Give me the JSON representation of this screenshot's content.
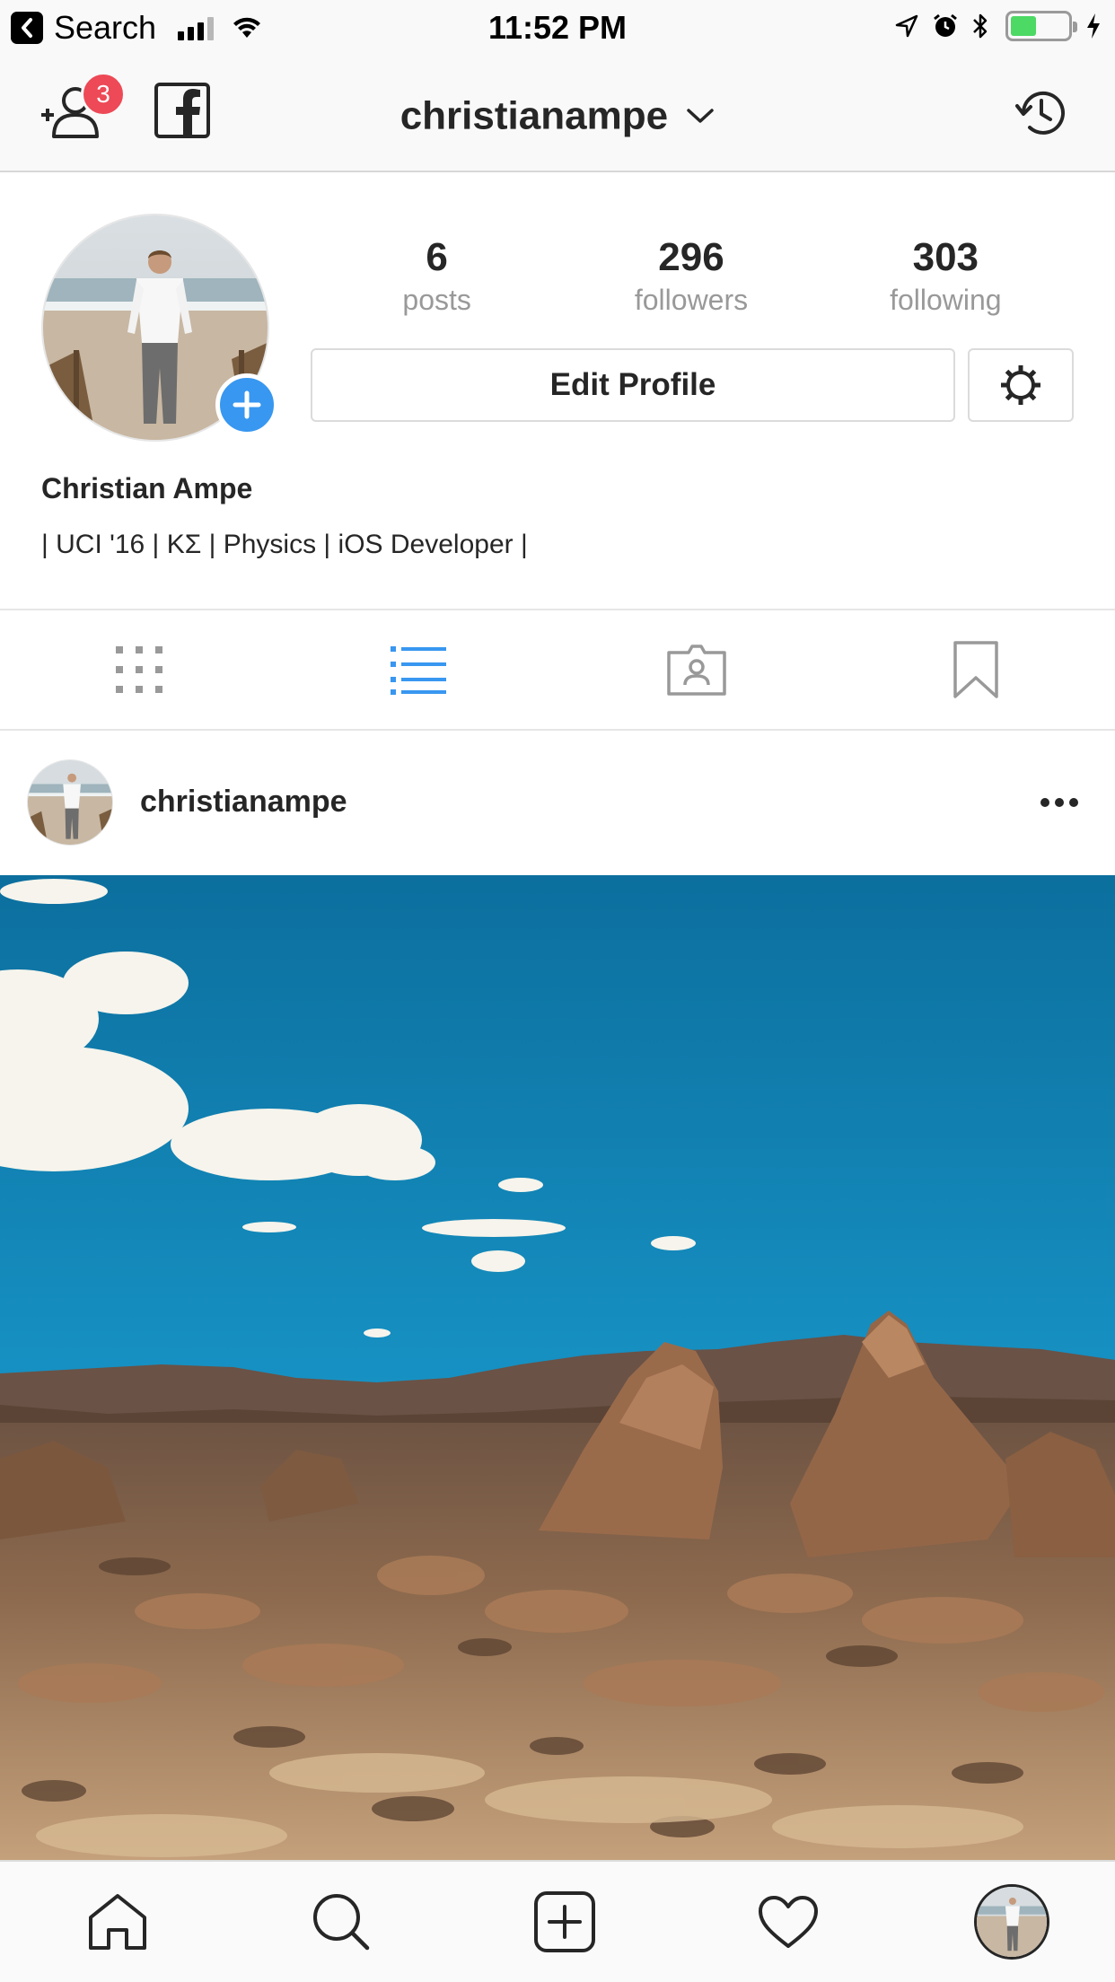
{
  "status_bar": {
    "back_label": "Search",
    "time": "11:52 PM",
    "battery_level": 0.45,
    "battery_color": "#4cd964",
    "icons": [
      "back-arrow-icon",
      "signal-bars-icon",
      "wifi-icon",
      "location-arrow-icon",
      "alarm-clock-icon",
      "bluetooth-icon",
      "battery-icon",
      "charging-bolt-icon"
    ]
  },
  "header": {
    "username": "christianampe",
    "badge_count": "3",
    "badge_color": "#ed4956",
    "icons": [
      "add-user-icon",
      "facebook-icon",
      "chevron-down-icon",
      "history-icon"
    ]
  },
  "profile": {
    "stats": [
      {
        "value": "6",
        "label": "posts"
      },
      {
        "value": "296",
        "label": "followers"
      },
      {
        "value": "303",
        "label": "following"
      }
    ],
    "edit_label": "Edit Profile",
    "full_name": "Christian Ampe",
    "bio": "| UCI '16 | ΚΣ | Physics | iOS Developer |",
    "accent_color": "#3897f0"
  },
  "tabs": [
    {
      "icon": "grid-icon",
      "active": false
    },
    {
      "icon": "list-icon",
      "active": true
    },
    {
      "icon": "tagged-icon",
      "active": false
    },
    {
      "icon": "bookmark-icon",
      "active": false
    }
  ],
  "post": {
    "username": "christianampe",
    "icons": [
      "more-options-icon"
    ]
  },
  "bottom_nav": [
    "home-icon",
    "search-icon",
    "new-post-icon",
    "activity-heart-icon",
    "profile-avatar"
  ]
}
